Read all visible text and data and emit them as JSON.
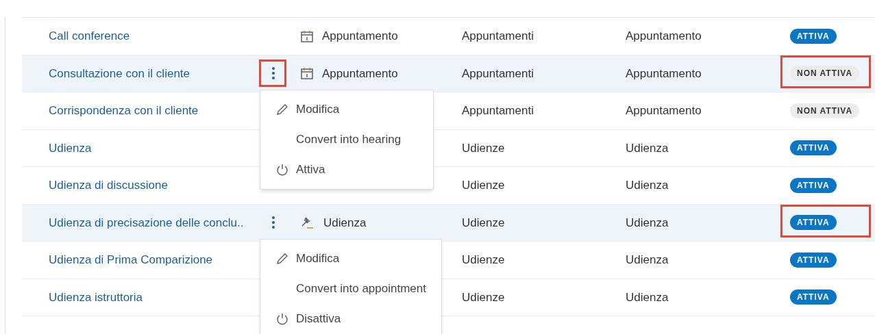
{
  "rows": [
    {
      "name": "Call conference",
      "selected": false,
      "kebab": false,
      "type": {
        "kind": "appointment",
        "label": "Appuntamento"
      },
      "category": "Appuntamenti",
      "kind_label": "Appuntamento",
      "status": {
        "label": "ATTIVA",
        "active": true
      },
      "status_marked": false
    },
    {
      "name": "Consultazione con il cliente",
      "selected": true,
      "kebab": true,
      "kebab_marked": true,
      "type": {
        "kind": "appointment",
        "label": "Appuntamento"
      },
      "category": "Appuntamenti",
      "kind_label": "Appuntamento",
      "status": {
        "label": "NON ATTIVA",
        "active": false
      },
      "status_marked": true,
      "menu": [
        {
          "kind": "edit",
          "label": "Modifica"
        },
        {
          "kind": "plain",
          "label": "Convert into hearing"
        },
        {
          "kind": "toggle",
          "label": "Attiva"
        }
      ]
    },
    {
      "name": "Corrispondenza con il cliente",
      "selected": false,
      "kebab": false,
      "category": "Appuntamenti",
      "kind_label": "Appuntamento",
      "status": {
        "label": "NON ATTIVA",
        "active": false
      },
      "status_marked": false
    },
    {
      "name": "Udienza",
      "selected": false,
      "kebab": false,
      "category": "Udienze",
      "kind_label": "Udienza",
      "status": {
        "label": "ATTIVA",
        "active": true
      },
      "status_marked": false
    },
    {
      "name": "Udienza di discussione",
      "selected": false,
      "kebab": false,
      "category": "Udienze",
      "kind_label": "Udienza",
      "status": {
        "label": "ATTIVA",
        "active": true
      },
      "status_marked": false
    },
    {
      "name": "Udienza di precisazione delle conclu..",
      "selected": true,
      "kebab": true,
      "kebab_marked": false,
      "type": {
        "kind": "hearing",
        "label": "Udienza"
      },
      "category": "Udienze",
      "kind_label": "Udienza",
      "status": {
        "label": "ATTIVA",
        "active": true
      },
      "status_marked": true,
      "menu": [
        {
          "kind": "edit",
          "label": "Modifica"
        },
        {
          "kind": "plain",
          "label": "Convert into appointment"
        },
        {
          "kind": "toggle",
          "label": "Disattiva"
        }
      ]
    },
    {
      "name": "Udienza di Prima Comparizione",
      "selected": false,
      "kebab": false,
      "category": "Udienze",
      "kind_label": "Udienza",
      "status": {
        "label": "ATTIVA",
        "active": true
      },
      "status_marked": false
    },
    {
      "name": "Udienza istruttoria",
      "selected": false,
      "kebab": false,
      "category": "Udienze",
      "kind_label": "Udienza",
      "status": {
        "label": "ATTIVA",
        "active": true
      },
      "status_marked": false
    }
  ]
}
